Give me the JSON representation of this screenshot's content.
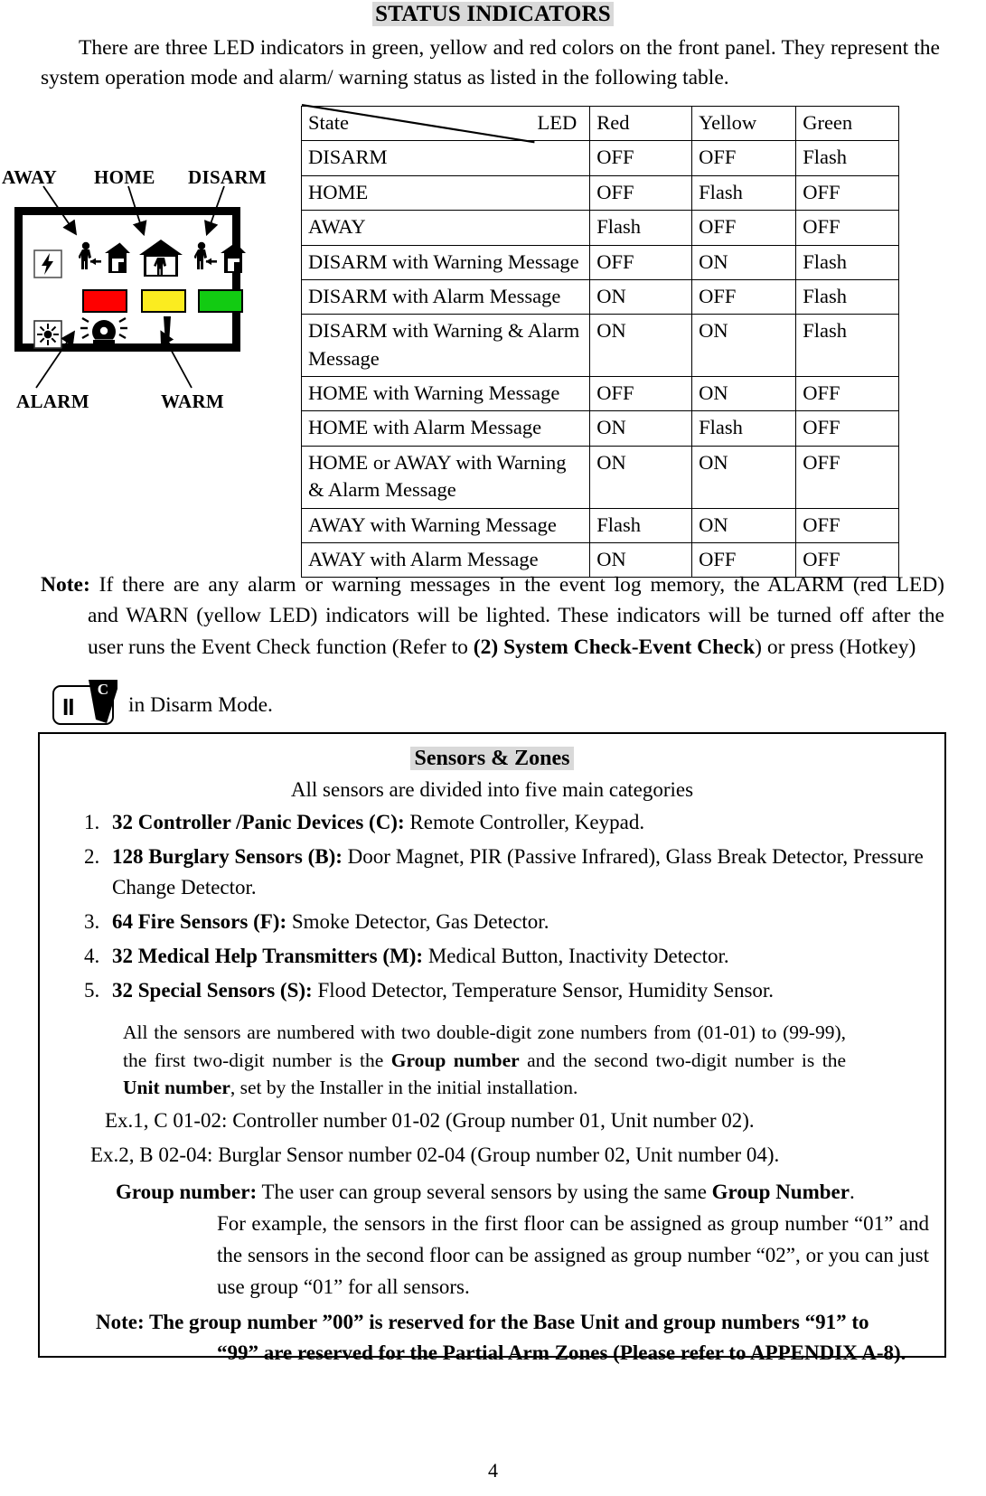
{
  "heading": {
    "title": "STATUS INDICATORS",
    "intro": "There are three LED indicators in green, yellow and red colors on the front panel. They represent the system operation mode and alarm/ warning status as listed in the following table."
  },
  "led_table": {
    "header": {
      "state": "State",
      "led": "LED",
      "red": "Red",
      "yellow": "Yellow",
      "green": "Green"
    },
    "rows": [
      {
        "state": "DISARM",
        "red": "OFF",
        "yellow": "OFF",
        "green": "Flash"
      },
      {
        "state": "HOME",
        "red": "OFF",
        "yellow": "Flash",
        "green": "OFF"
      },
      {
        "state": "AWAY",
        "red": "Flash",
        "yellow": "OFF",
        "green": "OFF"
      },
      {
        "state": "DISARM with Warning Message",
        "red": "OFF",
        "yellow": "ON",
        "green": "Flash"
      },
      {
        "state": "DISARM with Alarm Message",
        "red": "ON",
        "yellow": "OFF",
        "green": "Flash"
      },
      {
        "state": "DISARM with Warning & Alarm Message",
        "red": "ON",
        "yellow": "ON",
        "green": "Flash"
      },
      {
        "state": "HOME with Warning Message",
        "red": "OFF",
        "yellow": "ON",
        "green": "OFF"
      },
      {
        "state": "HOME with Alarm Message",
        "red": "ON",
        "yellow": "Flash",
        "green": "OFF"
      },
      {
        "state": "HOME or AWAY with Warning & Alarm Message",
        "red": "ON",
        "yellow": "ON",
        "green": "OFF"
      },
      {
        "state": "AWAY with Warning Message",
        "red": "Flash",
        "yellow": "ON",
        "green": "OFF"
      },
      {
        "state": "AWAY with Alarm Message",
        "red": "ON",
        "yellow": "OFF",
        "green": "OFF"
      }
    ]
  },
  "panel_diagram": {
    "labels": {
      "away": "AWAY",
      "home": "HOME",
      "disarm": "DISARM",
      "alarm": "ALARM",
      "warm": "WARM"
    },
    "led_colors": {
      "red": "#FE0000",
      "yellow": "#FBEC20",
      "green": "#12CB12"
    }
  },
  "note": {
    "label": "Note:",
    "line1": "If there are any alarm or warning messages in the event log memory, the ALARM (red LED)",
    "line2": "and WARN (yellow LED) indicators will be lighted. These indicators will be turned off after the",
    "line3_a": "user runs the Event Check function (Refer to ",
    "line3_bold": "(2) System Check-Event Check",
    "line3_b": ") or press (Hotkey)",
    "hotkey_glyph": "II",
    "hotkey_superscript": "C",
    "after_hotkey": "in Disarm Mode."
  },
  "sensors": {
    "title": "Sensors & Zones",
    "subtitle": "All sensors are divided into five main categories",
    "categories": [
      {
        "bold": "32 Controller /Panic Devices (C):",
        "rest": " Remote Controller, Keypad."
      },
      {
        "bold": "128 Burglary Sensors (B):",
        "rest": " Door Magnet, PIR (Passive Infrared), Glass Break Detector, Pressure Change Detector."
      },
      {
        "bold": "64 Fire Sensors (F):",
        "rest": " Smoke Detector, Gas Detector."
      },
      {
        "bold": "32 Medical Help Transmitters (M):",
        "rest": " Medical Button, Inactivity Detector."
      },
      {
        "bold": "32 Special Sensors (S):",
        "rest": " Flood Detector, Temperature Sensor, Humidity Sensor."
      }
    ],
    "numbering_para": {
      "p1": "All the sensors are numbered with two double-digit zone numbers from (01-01) to (99-99), the first two-digit number is the ",
      "b1": "Group number",
      "p2": " and the second two-digit number is the ",
      "b2": "Unit number",
      "p3": ", set by the Installer in the initial installation."
    },
    "examples": [
      "Ex.1, C 01-02: Controller number 01-02    (Group number 01, Unit number 02).",
      "Ex.2, B 02-04: Burglar Sensor number 02-04    (Group number 02, Unit number 04)."
    ],
    "group_number": {
      "bold_label": "Group number:",
      "text_a": " The user can group several sensors by using the same ",
      "bold_inline": "Group Number",
      "text_b": ".",
      "body": "For example, the sensors in the first floor can be assigned as group number “01” and the sensors in the second floor can be assigned as group number “02”, or you can just use group “01” for all sensors."
    },
    "group_note": {
      "line1": "Note: The group number ”00” is reserved for the Base Unit and group numbers “91” to",
      "line2": "“99” are reserved for the Partial Arm Zones (Please refer to APPENDIX A-8)."
    }
  },
  "footer": {
    "page_number": "4"
  }
}
